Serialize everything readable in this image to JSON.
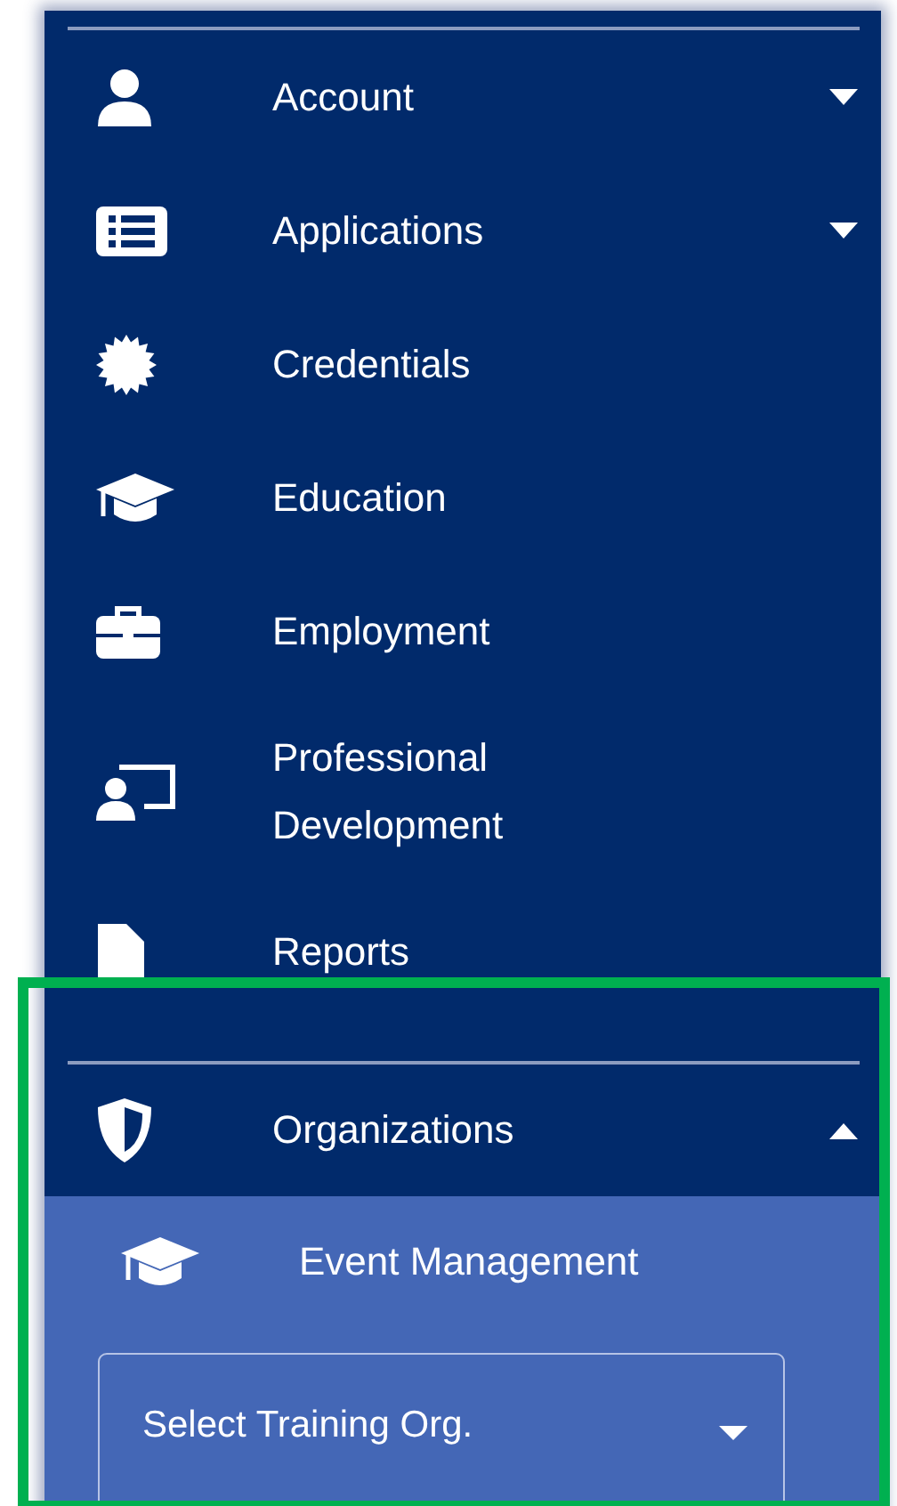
{
  "menu": [
    {
      "label": "Account",
      "kind": "user",
      "expanded": false
    },
    {
      "label": "Applications",
      "kind": "list",
      "expanded": false
    },
    {
      "label": "Credentials",
      "kind": "badge"
    },
    {
      "label": "Education",
      "kind": "cap"
    },
    {
      "label": "Employment",
      "kind": "briefcase"
    },
    {
      "label": "Professional Development",
      "kind": "teacher"
    },
    {
      "label": "Reports",
      "kind": "file"
    }
  ],
  "organizations": {
    "label": "Organizations",
    "kind": "shield",
    "expanded": true,
    "children": [
      {
        "label": "Event Management",
        "kind": "cap"
      }
    ],
    "select": {
      "placeholder": "Select Training Org."
    }
  }
}
